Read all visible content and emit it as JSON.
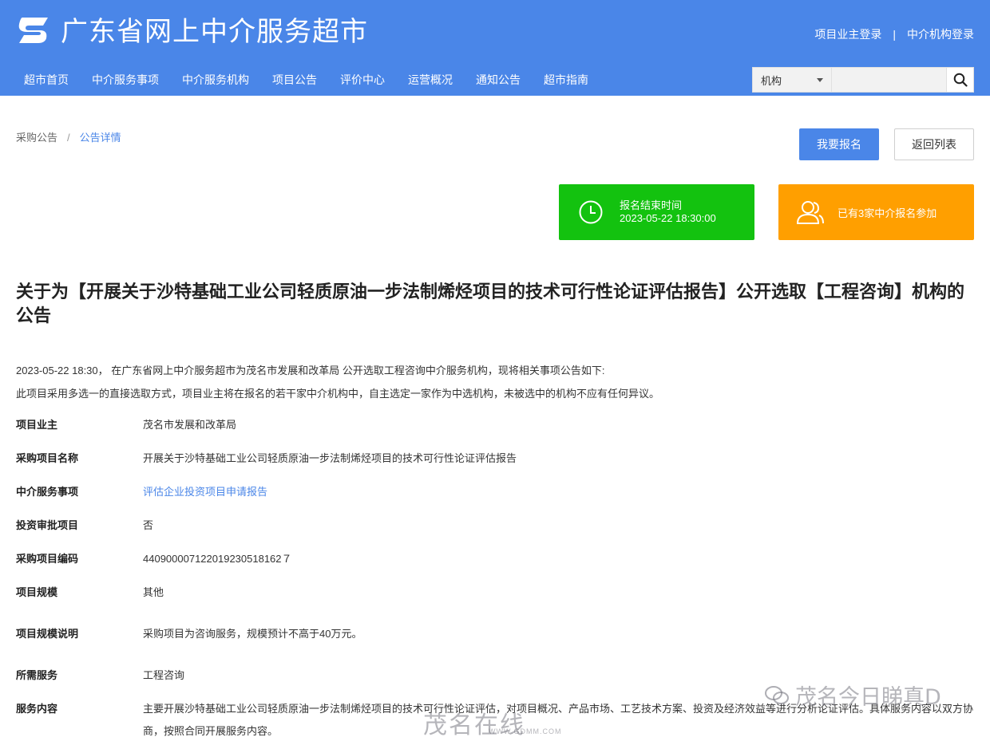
{
  "header": {
    "site_title": "广东省网上中介服务超市",
    "owner_login": "项目业主登录",
    "separator": "|",
    "agency_login": "中介机构登录",
    "nav": [
      {
        "label": "超市首页"
      },
      {
        "label": "中介服务事项"
      },
      {
        "label": "中介服务机构"
      },
      {
        "label": "项目公告"
      },
      {
        "label": "评价中心"
      },
      {
        "label": "运营概况"
      },
      {
        "label": "通知公告"
      },
      {
        "label": "超市指南"
      }
    ],
    "search": {
      "selected": "机构",
      "placeholder": "",
      "icon": "search-icon"
    }
  },
  "breadcrumb": {
    "parent": "采购公告",
    "separator": "/",
    "current": "公告详情"
  },
  "actions": {
    "signup": "我要报名",
    "back": "返回列表"
  },
  "cards": {
    "deadline_label": "报名结束时间",
    "deadline_value": "2023-05-22 18:30:00",
    "participants": "已有3家中介报名参加"
  },
  "colors": {
    "brand": "#4a86e8",
    "green": "#13c20f",
    "orange": "#ff9f00"
  },
  "notice": {
    "title": "关于为【开展关于沙特基础工业公司轻质原油一步法制烯烃项目的技术可行性论证评估报告】公开选取【工程咨询】机构的公告",
    "intro_line1": "2023-05-22 18:30， 在广东省网上中介服务超市为茂名市发展和改革局 公开选取工程咨询中介服务机构，现将相关事项公告如下:",
    "intro_line2": "此项目采用多选一的直接选取方式，项目业主将在报名的若干家中介机构中，自主选定一家作为中选机构，未被选中的机构不应有任何异议。"
  },
  "details": [
    {
      "label": "项目业主",
      "value": "茂名市发展和改革局"
    },
    {
      "label": "采购项目名称",
      "value": "开展关于沙特基础工业公司轻质原油一步法制烯烃项目的技术可行性论证评估报告"
    },
    {
      "label": "中介服务事项",
      "value": "评估企业投资项目申请报告"
    },
    {
      "label": "投资审批项目",
      "value": "否"
    },
    {
      "label": "采购项目编码",
      "value": "440900007122019230518162７"
    },
    {
      "label": "项目规模",
      "value": "其他"
    },
    {
      "label": "项目规模说明",
      "value": "采购项目为咨询服务，规模预计不高于40万元。"
    },
    {
      "label": "所需服务",
      "value": "工程咨询"
    },
    {
      "label": "服务内容",
      "value": "主要开展沙特基础工业公司轻质原油一步法制烯烃项目的技术可行性论证评估，对项目概况、产品市场、工艺技术方案、投资及经济效益等进行分析论证评估。具体服务内容以双方协商，按照合同开展服务内容。"
    }
  ],
  "watermark": {
    "account": "茂名今日睇真D",
    "brand": "茂名在线",
    "url": "WWW.GDMM.COM"
  }
}
